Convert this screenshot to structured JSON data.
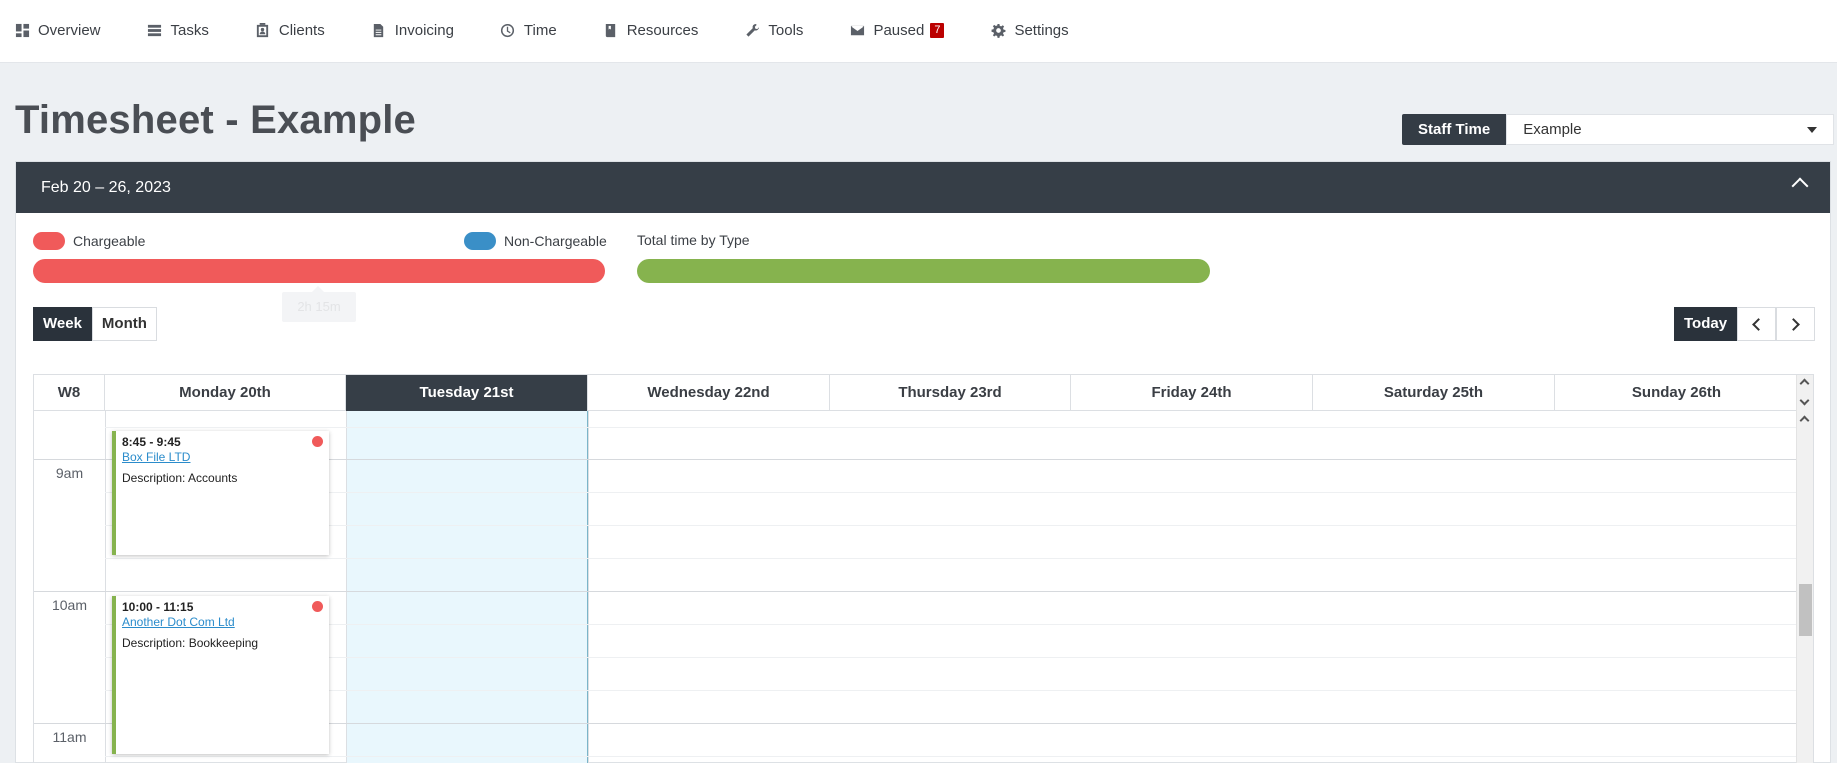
{
  "nav": [
    {
      "label": "Overview",
      "icon": "dashboard-icon"
    },
    {
      "label": "Tasks",
      "icon": "tasks-icon"
    },
    {
      "label": "Clients",
      "icon": "clients-icon"
    },
    {
      "label": "Invoicing",
      "icon": "invoice-icon"
    },
    {
      "label": "Time",
      "icon": "clock-icon"
    },
    {
      "label": "Resources",
      "icon": "book-icon"
    },
    {
      "label": "Tools",
      "icon": "wrench-icon"
    },
    {
      "label": "Paused",
      "icon": "envelope-icon",
      "badge": "7"
    },
    {
      "label": "Settings",
      "icon": "gear-icon"
    }
  ],
  "page": {
    "title": "Timesheet - Example"
  },
  "staff": {
    "label": "Staff Time",
    "selected": "Example"
  },
  "panel": {
    "date_range": "Feb 20 – 26, 2023"
  },
  "legend": {
    "chargeable": "Chargeable",
    "non_chargeable": "Non-Chargeable",
    "total_by_type": "Total time by Type",
    "tooltip": "2h 15m"
  },
  "colors": {
    "chargeable": "#f05a5a",
    "non_chargeable": "#3a8fc7",
    "total": "#86b34e"
  },
  "view": {
    "week": "Week",
    "month": "Month",
    "today": "Today"
  },
  "calendar": {
    "week_label": "W8",
    "days": [
      "Monday 20th",
      "Tuesday 21st",
      "Wednesday 22nd",
      "Thursday 23rd",
      "Friday 24th",
      "Saturday 25th",
      "Sunday 26th"
    ],
    "hours": [
      "9am",
      "10am",
      "11am"
    ],
    "events": [
      {
        "time": "8:45 - 9:45",
        "client": "Box File LTD",
        "description": "Description: Accounts"
      },
      {
        "time": "10:00 - 11:15",
        "client": "Another Dot Com Ltd",
        "description": "Description: Bookkeeping"
      }
    ]
  }
}
